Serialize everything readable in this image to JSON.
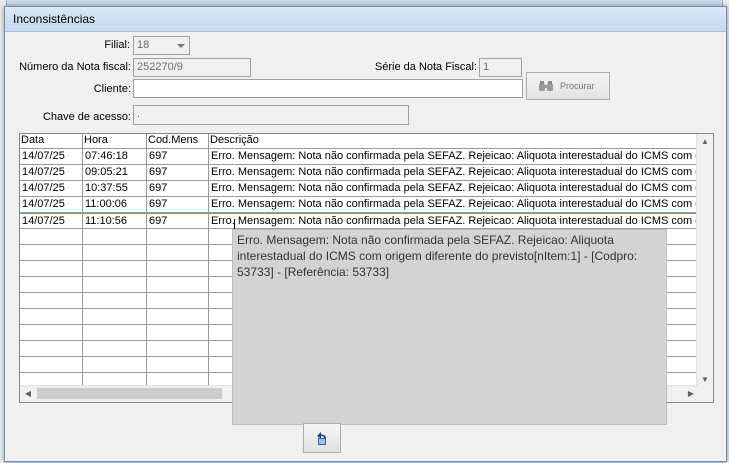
{
  "window": {
    "title": "Inconsistências"
  },
  "form": {
    "filial_label": "Filial:",
    "filial_value": "18",
    "numero_label": "Número da Nota fiscal:",
    "numero_value": "252270/9",
    "serie_label": "Série da Nota Fiscal:",
    "serie_value": "1",
    "cliente_label": "Cliente:",
    "cliente_value": "",
    "chave_label": "Chave de acesso:",
    "chave_value": ".",
    "procurar_label": "Procurar"
  },
  "grid": {
    "columns": [
      "Data",
      "Hora",
      "Cod.Mens",
      "Descrição"
    ],
    "rows": [
      [
        "14/07/25",
        "07:46:18",
        "697",
        "Erro. Mensagem: Nota não confirmada pela SEFAZ. Rejeicao: Aliquota interestadual do ICMS com origem diferente do previsto"
      ],
      [
        "14/07/25",
        "09:05:21",
        "697",
        "Erro. Mensagem: Nota não confirmada pela SEFAZ. Rejeicao: Aliquota interestadual do ICMS com origem diferente do previsto"
      ],
      [
        "14/07/25",
        "10:37:55",
        "697",
        "Erro. Mensagem: Nota não confirmada pela SEFAZ. Rejeicao: Aliquota interestadual do ICMS com origem diferente do previsto"
      ],
      [
        "14/07/25",
        "11:00:06",
        "697",
        "Erro. Mensagem: Nota não confirmada pela SEFAZ. Rejeicao: Aliquota interestadual do ICMS com origem diferente do previsto"
      ],
      [
        "14/07/25",
        "11:10:56",
        "697",
        "Erro. Mensagem: Nota não confirmada pela SEFAZ. Rejeicao: Aliquota interestadual do ICMS com origem diferente do previsto"
      ]
    ],
    "selected_row": 4,
    "empty_rows": 10
  },
  "tooltip": {
    "text": "Erro. Mensagem: Nota não confirmada pela SEFAZ. Rejeicao: Aliquota interestadual do ICMS com origem diferente do previsto[nItem:1] - [Codpro: 53733] - [Referência: 53733]"
  },
  "icons": {
    "undo": "undo-arrow-icon",
    "search": "binoculars-icon"
  },
  "colors": {
    "titlebar": "#c5d8ee",
    "tooltip_bg": "#d3d3d3",
    "selection_border": "#5b9bd5"
  }
}
